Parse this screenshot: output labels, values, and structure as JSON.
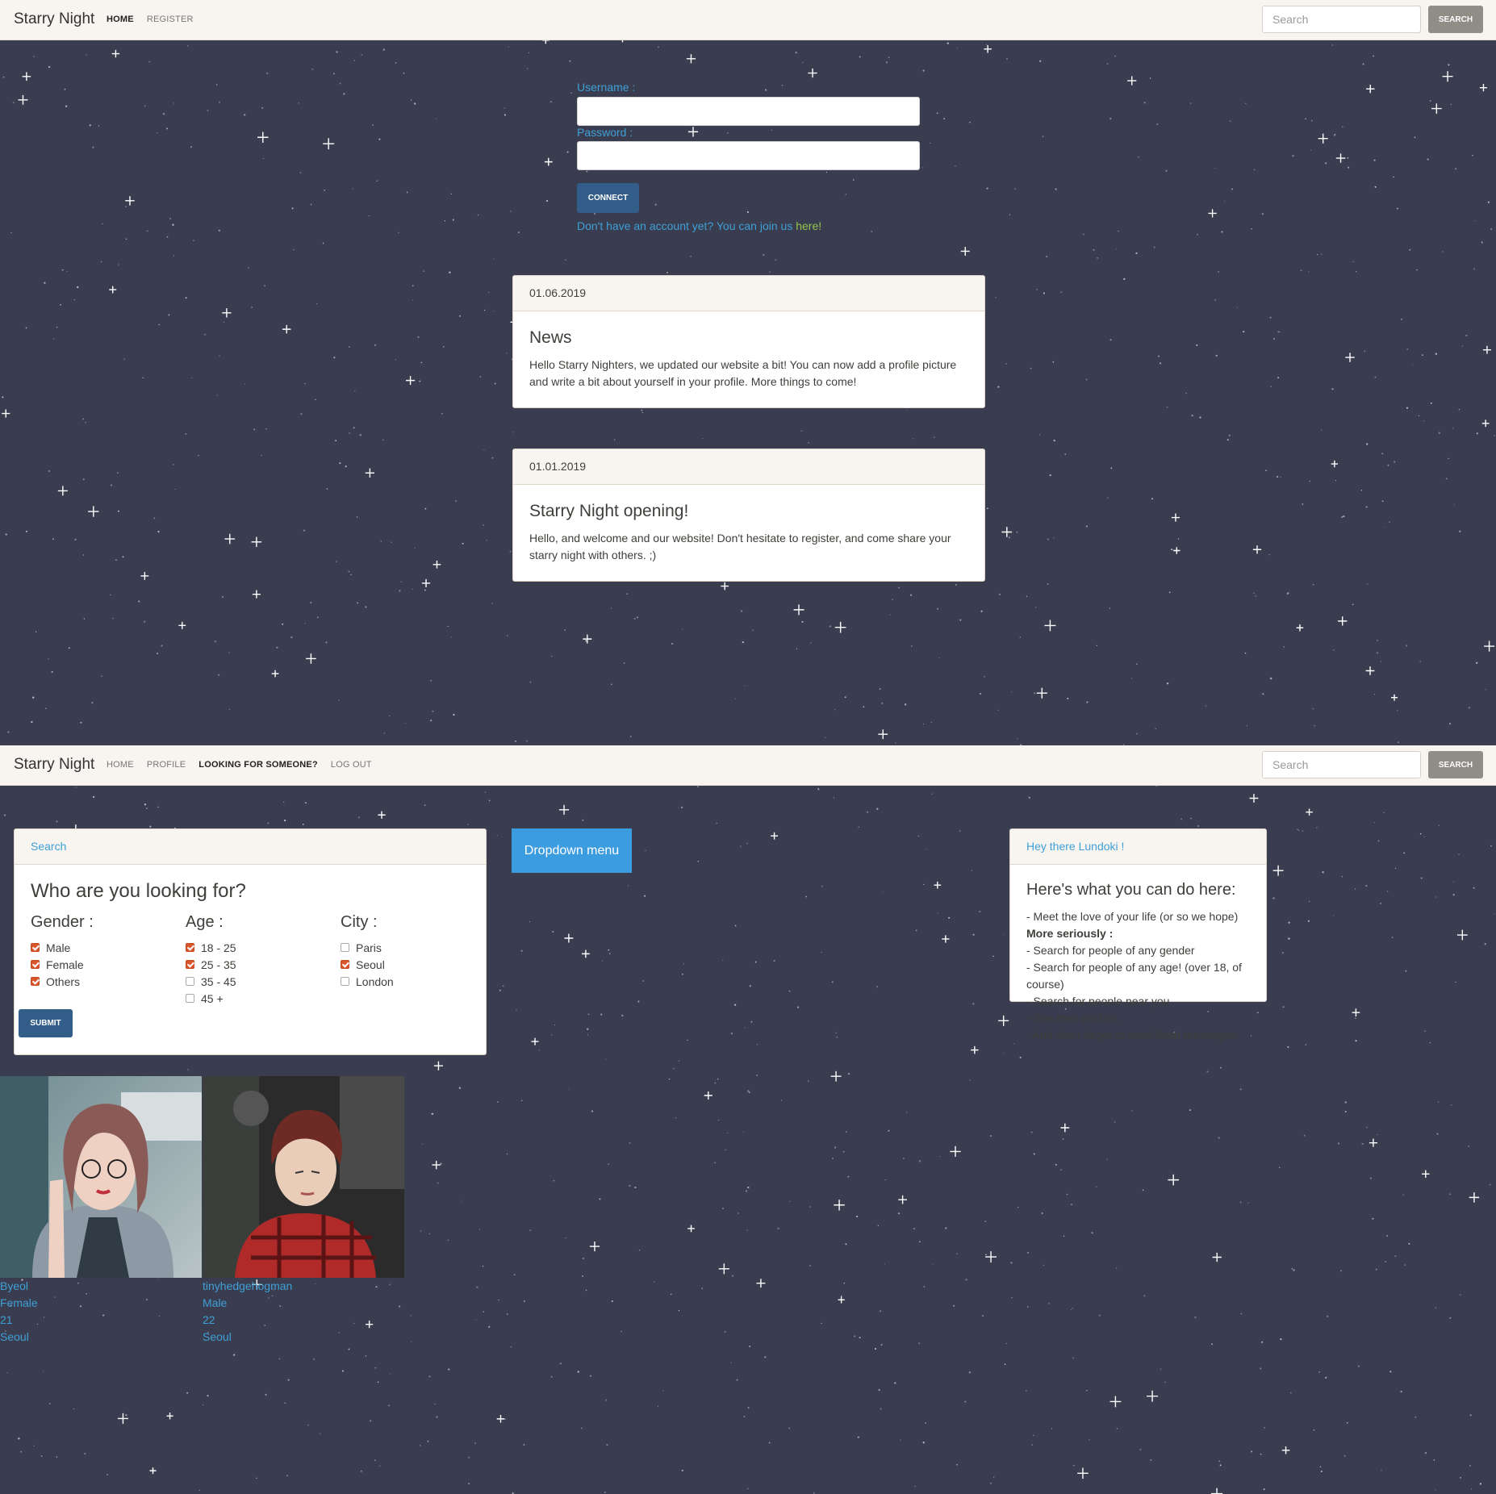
{
  "screen1": {
    "navbar": {
      "brand": "Starry Night",
      "links": [
        {
          "label": "HOME",
          "active": true
        },
        {
          "label": "REGISTER",
          "active": false
        }
      ],
      "search_placeholder": "Search",
      "search_button": "SEARCH"
    },
    "login": {
      "username_label": "Username :",
      "username_value": "",
      "password_label": "Password :",
      "password_value": "",
      "connect_button": "CONNECT",
      "join_text": "Don't have an account yet? You can join us ",
      "join_link": "here!"
    },
    "news": [
      {
        "date": "01.06.2019",
        "title": "News",
        "text": "Hello Starry Nighters, we updated our website a bit! You can now add a profile picture and write a bit about yourself in your profile. More things to come!"
      },
      {
        "date": "01.01.2019",
        "title": "Starry Night opening!",
        "text": "Hello, and welcome and our website! Don't hesitate to register, and come share your starry night with others. ;)"
      }
    ]
  },
  "screen2": {
    "navbar": {
      "brand": "Starry Night",
      "links": [
        {
          "label": "HOME",
          "active": false
        },
        {
          "label": "PROFILE",
          "active": false
        },
        {
          "label": "LOOKING FOR SOMEONE?",
          "active": true
        },
        {
          "label": "LOG OUT",
          "active": false
        }
      ],
      "search_placeholder": "Search",
      "search_button": "SEARCH"
    },
    "search_panel": {
      "header": "Search",
      "title": "Who are you looking for?",
      "gender_label": "Gender :",
      "gender_options": [
        {
          "label": "Male",
          "checked": true
        },
        {
          "label": "Female",
          "checked": true
        },
        {
          "label": "Others",
          "checked": true
        }
      ],
      "age_label": "Age :",
      "age_options": [
        {
          "label": "18 - 25",
          "checked": true
        },
        {
          "label": "25 - 35",
          "checked": true
        },
        {
          "label": "35 - 45",
          "checked": false
        },
        {
          "label": "45 +",
          "checked": false
        }
      ],
      "city_label": "City :",
      "city_options": [
        {
          "label": "Paris",
          "checked": false
        },
        {
          "label": "Seoul",
          "checked": true
        },
        {
          "label": "London",
          "checked": false
        }
      ],
      "submit_button": "SUBMIT"
    },
    "dropdown_button": "Dropdown menu",
    "info_panel": {
      "header": "Hey there Lundoki !",
      "title": "Here's what you can do here:",
      "items": [
        {
          "text": "- Meet the love of your life (or so we hope)",
          "bold": false
        },
        {
          "text": "More seriously :",
          "bold": true
        },
        {
          "text": "- Search for people of any gender",
          "bold": false
        },
        {
          "text": "- Search for people of any age! (over 18, of course)",
          "bold": false
        },
        {
          "text": "- Search for people near you",
          "bold": false
        },
        {
          "text": "- See their profiles",
          "bold": false
        },
        {
          "text": "- And don't forget to send them messages!",
          "bold": false
        }
      ]
    },
    "profiles": [
      {
        "name": "Byeol",
        "gender": "Female",
        "age": "21",
        "city": "Seoul"
      },
      {
        "name": "tinyhedgehogman",
        "gender": "Male",
        "age": "22",
        "city": "Seoul"
      }
    ]
  }
}
